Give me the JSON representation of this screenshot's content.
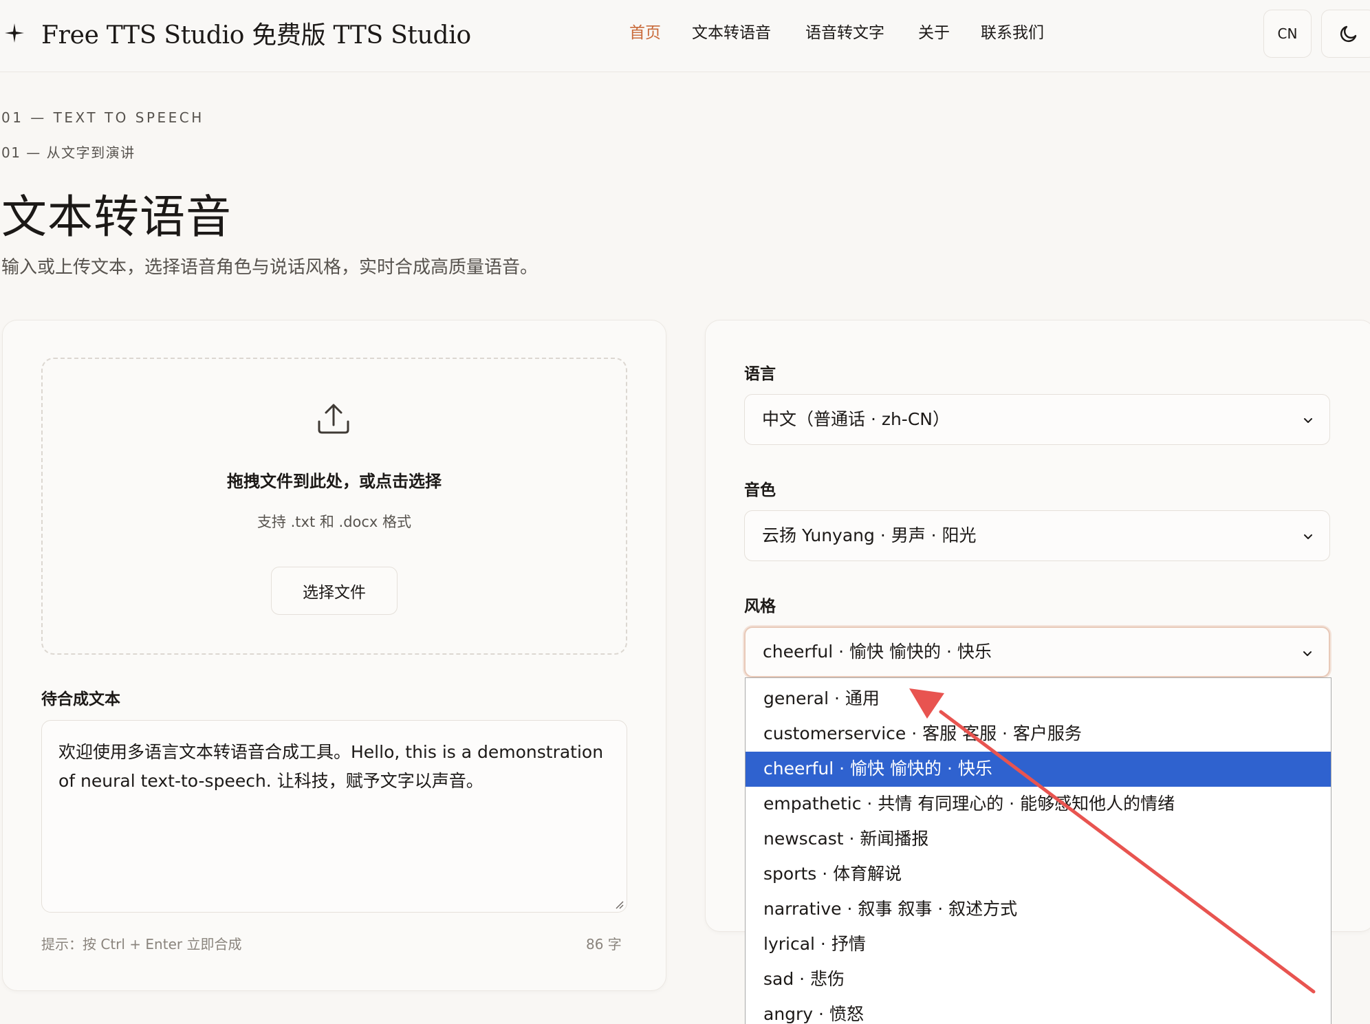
{
  "app": {
    "brand": "Free TTS Studio  免费版 TTS Studio"
  },
  "nav": {
    "items": [
      {
        "label": "首页",
        "active": true
      },
      {
        "label": "文本转语音",
        "active": false
      },
      {
        "label": "语音转文字",
        "active": false
      },
      {
        "label": "关于",
        "active": false
      },
      {
        "label": "联系我们",
        "active": false
      }
    ]
  },
  "header": {
    "lang_label": "CN"
  },
  "hero": {
    "eyebrow_en": "01 — TEXT TO SPEECH",
    "eyebrow_zh": "01 — 从文字到演讲",
    "title": "文本转语音",
    "subtitle": "输入或上传文本，选择语音角色与说话风格，实时合成高质量语音。"
  },
  "upload": {
    "title": "拖拽文件到此处，或点击选择",
    "hint": "支持 .txt 和 .docx 格式",
    "button": "选择文件"
  },
  "editor": {
    "label": "待合成文本",
    "text": "欢迎使用多语言文本转语音合成工具。Hello, this is a demonstration of neural text-to-speech. 让科技，赋予文字以声音。",
    "tip": "提示：按 Ctrl + Enter 立即合成",
    "count": "86  字"
  },
  "settings": {
    "language": {
      "label": "语言",
      "value": "中文（普通话 · zh-CN）"
    },
    "voice": {
      "label": "音色",
      "value": "云扬 Yunyang · 男声 · 阳光"
    },
    "style": {
      "label": "风格",
      "value": "cheerful · 愉快  愉快的 · 快乐",
      "options": [
        "general · 通用",
        "customerservice · 客服  客服 · 客户服务",
        "cheerful · 愉快  愉快的 · 快乐",
        "empathetic · 共情  有同理心的 · 能够感知他人的情绪",
        "newscast · 新闻播报",
        "sports · 体育解说",
        "narrative · 叙事  叙事 · 叙述方式",
        "lyrical · 抒情",
        "sad · 悲伤",
        "angry · 愤怒"
      ],
      "selected_index": 2
    }
  },
  "colors": {
    "accent": "#c96a3a",
    "selection": "#2f62cf",
    "annotation_arrow": "#e85450"
  }
}
